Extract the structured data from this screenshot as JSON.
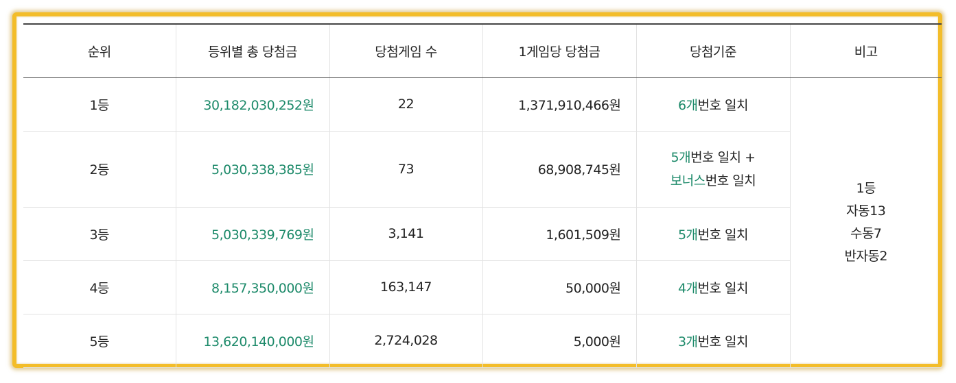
{
  "headers": [
    "순위",
    "등위별 총 당첨금",
    "당첨게임 수",
    "1게임당 당첨금",
    "당첨기준",
    "비고"
  ],
  "rows": [
    {
      "rank": "1등",
      "total": "30,182,030,252원",
      "games": "22",
      "per_game": "1,371,910,466원",
      "criteria": {
        "count": "6개",
        "text": "번호 일치"
      }
    },
    {
      "rank": "2등",
      "total": "5,030,338,385원",
      "games": "73",
      "per_game": "68,908,745원",
      "criteria": {
        "count": "5개",
        "text": "번호 일치 +",
        "bonus": "보너스",
        "bonus_text": "번호 일치"
      }
    },
    {
      "rank": "3등",
      "total": "5,030,339,769원",
      "games": "3,141",
      "per_game": "1,601,509원",
      "criteria": {
        "count": "5개",
        "text": "번호 일치"
      }
    },
    {
      "rank": "4등",
      "total": "8,157,350,000원",
      "games": "163,147",
      "per_game": "50,000원",
      "criteria": {
        "count": "4개",
        "text": "번호 일치"
      }
    },
    {
      "rank": "5등",
      "total": "13,620,140,000원",
      "games": "2,724,028",
      "per_game": "5,000원",
      "criteria": {
        "count": "3개",
        "text": "번호 일치"
      }
    }
  ],
  "note": [
    "1등",
    "자동13",
    "수동7",
    "반자동2"
  ],
  "colors": {
    "accent": "#1d8a6a",
    "frame": "#f3bd2a",
    "text": "#222222"
  }
}
